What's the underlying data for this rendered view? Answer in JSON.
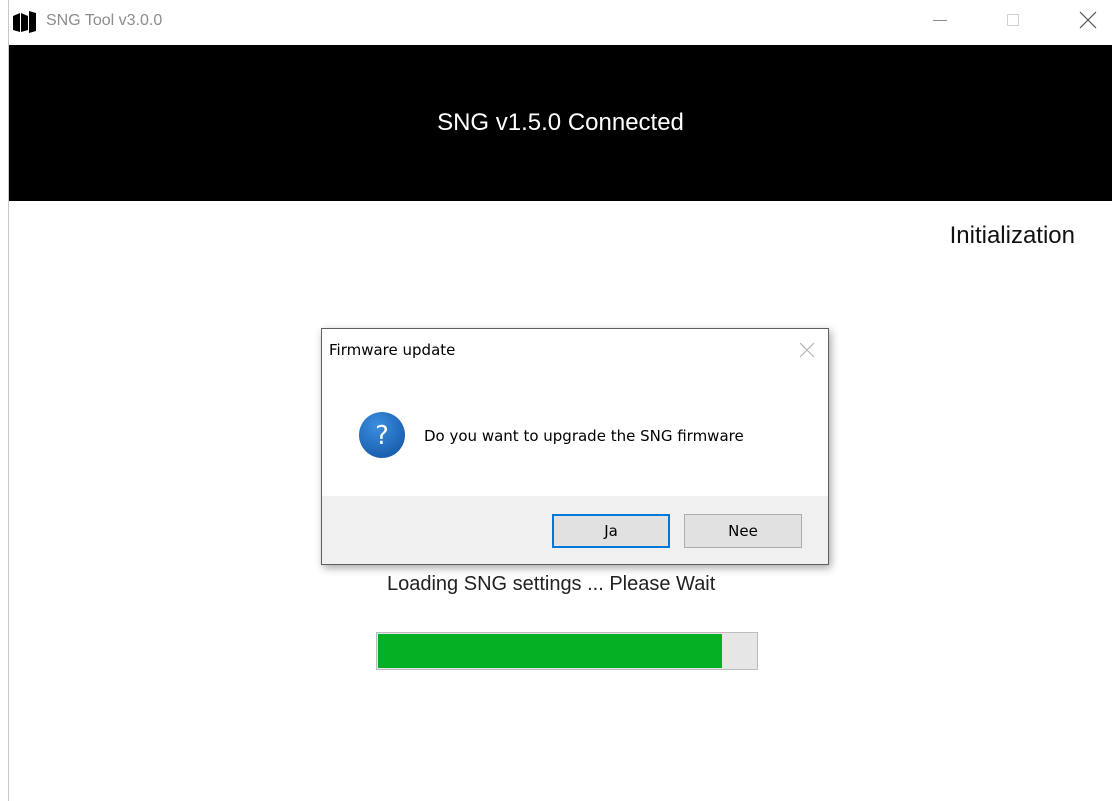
{
  "window": {
    "title": "SNG Tool v3.0.0"
  },
  "header": {
    "status_text": "SNG v1.5.0 Connected"
  },
  "stage": {
    "label": "Initialization"
  },
  "loading": {
    "text": "Loading SNG settings ... Please Wait",
    "progress_fraction": 0.91,
    "progress_color": "#06b025"
  },
  "dialog": {
    "title": "Firmware update",
    "message": "Do you want to upgrade the SNG firmware",
    "icon": "question-icon",
    "buttons": {
      "yes_label": "Ja",
      "no_label": "Nee"
    }
  },
  "colors": {
    "header_bg": "#000000",
    "accent": "#0078d7",
    "question_icon": "#1e6ec2"
  }
}
